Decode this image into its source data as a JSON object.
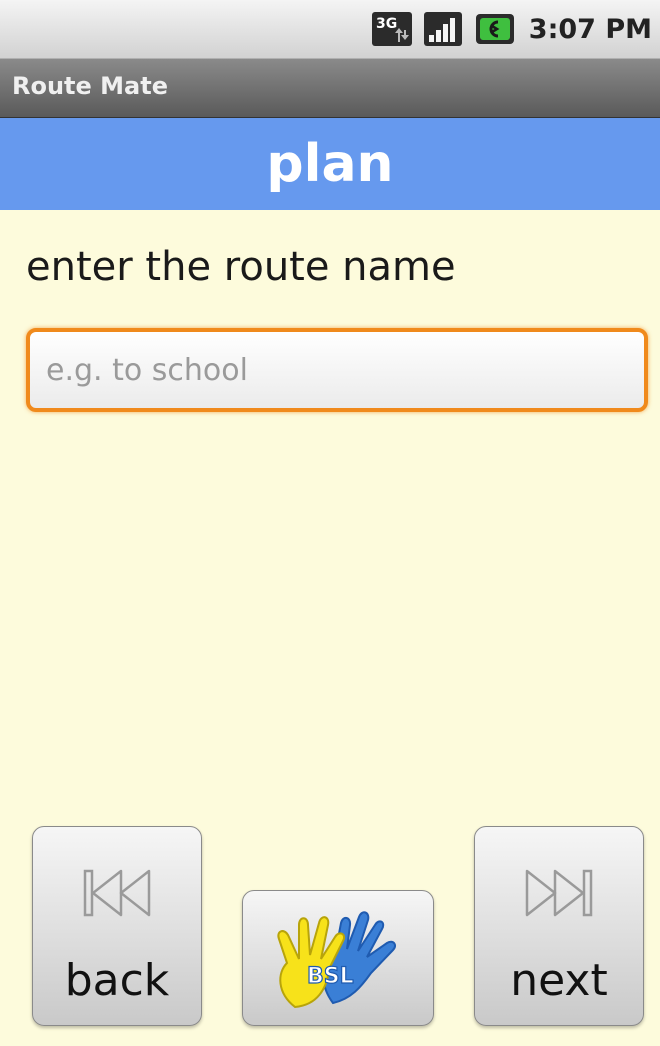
{
  "status_bar": {
    "network_icon": "3g-icon",
    "signal_icon": "signal-strength-icon",
    "battery_icon": "battery-icon",
    "time": "3:07 PM"
  },
  "app": {
    "title": "Route Mate"
  },
  "header": {
    "title": "plan"
  },
  "form": {
    "prompt": "enter the route name",
    "route_name_value": "",
    "route_name_placeholder": "e.g. to school"
  },
  "nav": {
    "back_label": "back",
    "back_icon": "skip-back-icon",
    "next_label": "next",
    "next_icon": "skip-forward-icon",
    "bsl_logo_text": "BSL",
    "bsl_icon": "bsl-sign-language-hands-icon"
  },
  "colors": {
    "header_band": "#6699ee",
    "background": "#fdfbdc",
    "input_focus_border": "#f08a1c"
  }
}
